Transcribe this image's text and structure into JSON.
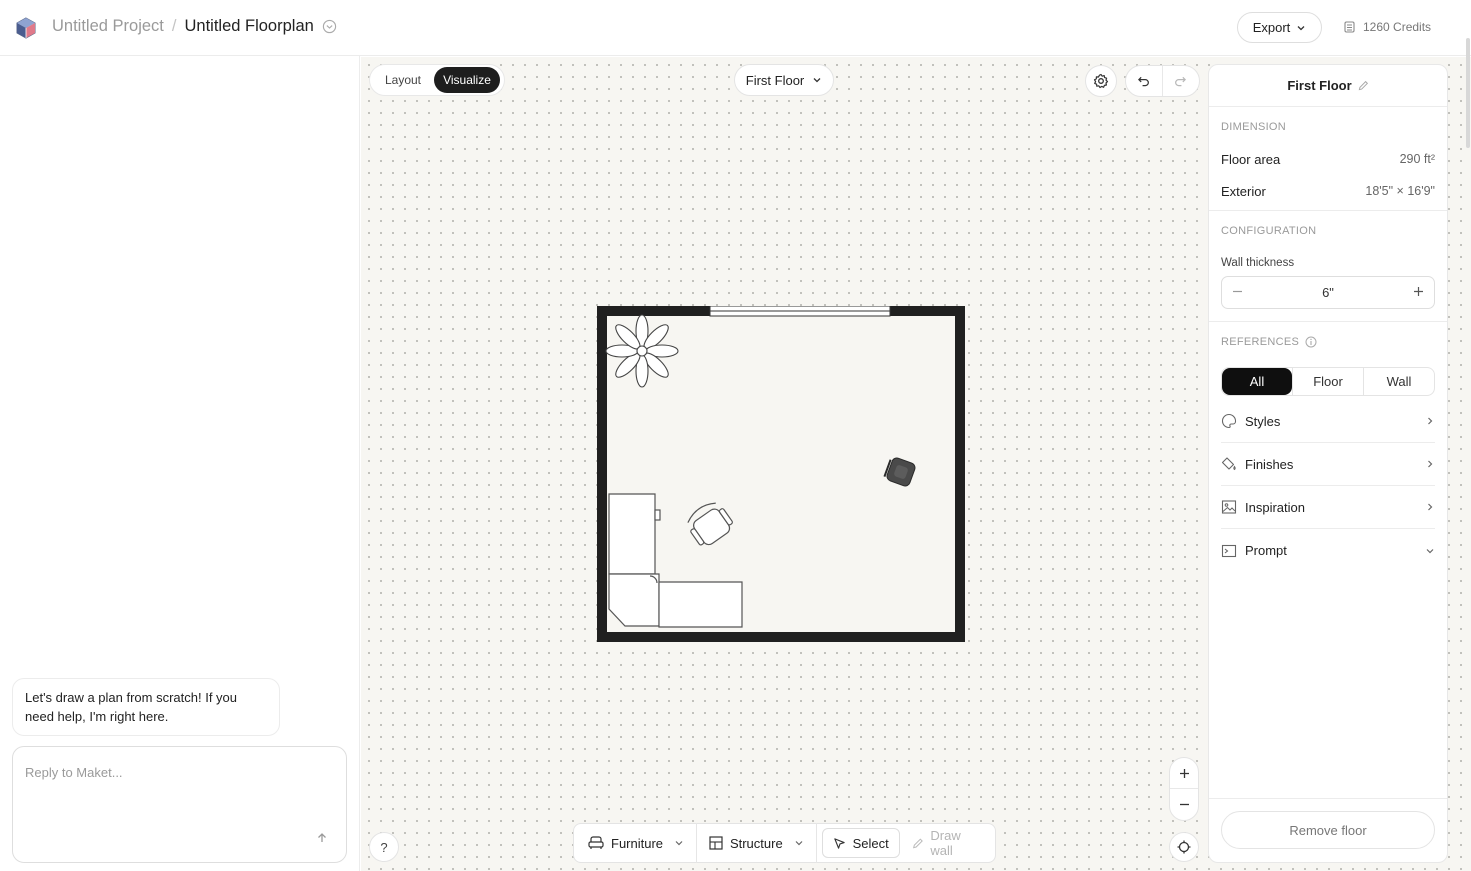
{
  "header": {
    "project_name": "Untitled Project",
    "separator": "/",
    "plan_name": "Untitled Floorplan",
    "export_label": "Export",
    "credits": "1260 Credits"
  },
  "chat": {
    "message": "Let's draw a plan from scratch! If you need help, I'm right here.",
    "reply_placeholder": "Reply to Maket..."
  },
  "canvas": {
    "mode_layout": "Layout",
    "mode_visualize": "Visualize",
    "active_mode": "Visualize",
    "floor_select": "First Floor",
    "help_label": "?",
    "toolbar": {
      "furniture": "Furniture",
      "structure": "Structure",
      "select": "Select",
      "draw_wall": "Draw wall"
    }
  },
  "properties": {
    "title": "First Floor",
    "dimension": {
      "label": "DIMENSION",
      "floor_area_label": "Floor area",
      "floor_area_value": "290 ft²",
      "exterior_label": "Exterior",
      "exterior_value": "18'5\" × 16'9\""
    },
    "configuration": {
      "label": "CONFIGURATION",
      "wall_thickness_label": "Wall thickness",
      "wall_thickness_value": "6\""
    },
    "references": {
      "label": "REFERENCES",
      "tabs": [
        "All",
        "Floor",
        "Wall"
      ],
      "active_tab": "All",
      "items": [
        {
          "label": "Styles",
          "icon": "palette-icon",
          "chevron": "right"
        },
        {
          "label": "Finishes",
          "icon": "paint-bucket-icon",
          "chevron": "right"
        },
        {
          "label": "Inspiration",
          "icon": "image-icon",
          "chevron": "right"
        },
        {
          "label": "Prompt",
          "icon": "terminal-icon",
          "chevron": "down"
        }
      ]
    },
    "remove_floor_label": "Remove floor"
  },
  "colors": {
    "canvas_bg": "#f7f6f2",
    "wall": "#222222",
    "accent_dark": "#1e1e1e"
  }
}
